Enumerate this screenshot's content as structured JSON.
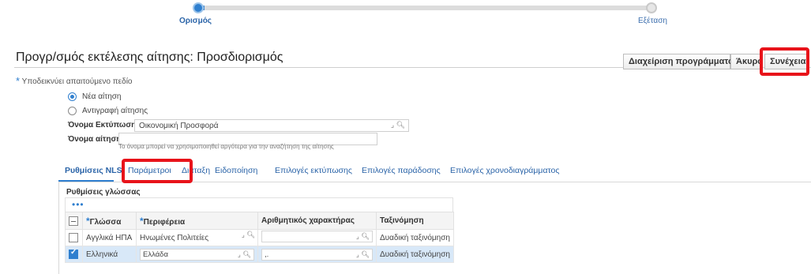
{
  "train": {
    "steps": [
      {
        "label": "Ορισμός",
        "state": "active"
      },
      {
        "label": "Εξέταση",
        "state": "inactive"
      }
    ]
  },
  "page": {
    "title": "Προγρ/σμός εκτέλεσης αίτησης: Προσδιορισμός"
  },
  "buttons": {
    "manage": "Διαχείριση προγράμματος",
    "cancel": "Άκυρο",
    "continue": "Συνέχεια"
  },
  "required_note": "Υποδεικνύει απαιτούμενο πεδίο",
  "request_type": {
    "options": [
      {
        "label": "Νέα αίτηση",
        "selected": true
      },
      {
        "label": "Αντιγραφή αίτησης",
        "selected": false
      }
    ]
  },
  "form": {
    "print_name_label": "Όνομα Εκτύπωσης",
    "print_name_value": "Οικονομική Προσφορά",
    "request_name_label": "Όνομα αίτησης",
    "request_name_value": "",
    "request_name_hint": "Το όνομα μπορεί να χρησιμοποιηθεί αργότερα για την αναζήτηση της αίτησης"
  },
  "tabs": [
    {
      "label": "Ρυθμίσεις NLS",
      "active": true
    },
    {
      "label": "Παράμετροι",
      "active": false
    },
    {
      "label": "Διάταξη",
      "active": false
    },
    {
      "label": "Ειδοποίηση",
      "active": false
    },
    {
      "label": "Επιλογές εκτύπωσης",
      "active": false
    },
    {
      "label": "Επιλογές παράδοσης",
      "active": false
    },
    {
      "label": "Επιλογές χρονοδιαγράμματος",
      "active": false
    }
  ],
  "nls": {
    "section_title": "Ρυθμίσεις γλώσσας",
    "toolbar_dots": "•••",
    "columns": [
      "Γλώσσα",
      "Περιφέρεια",
      "Αριθμητικός χαρακτήρας",
      "Ταξινόμηση"
    ],
    "rows": [
      {
        "checked": false,
        "language": "Αγγλικά ΗΠΑ",
        "territory": "Ηνωμένες Πολιτείες",
        "numeric": "",
        "sort": "Δυαδική ταξινόμηση"
      },
      {
        "checked": true,
        "language": "Ελληνικά",
        "territory": "Ελλάδα",
        "numeric": ",.",
        "sort": "Δυαδική ταξινόμηση"
      }
    ]
  },
  "colors": {
    "accent": "#2f7fcf",
    "highlight_box": "#e8131a",
    "selected_row": "#d8e8f8"
  }
}
